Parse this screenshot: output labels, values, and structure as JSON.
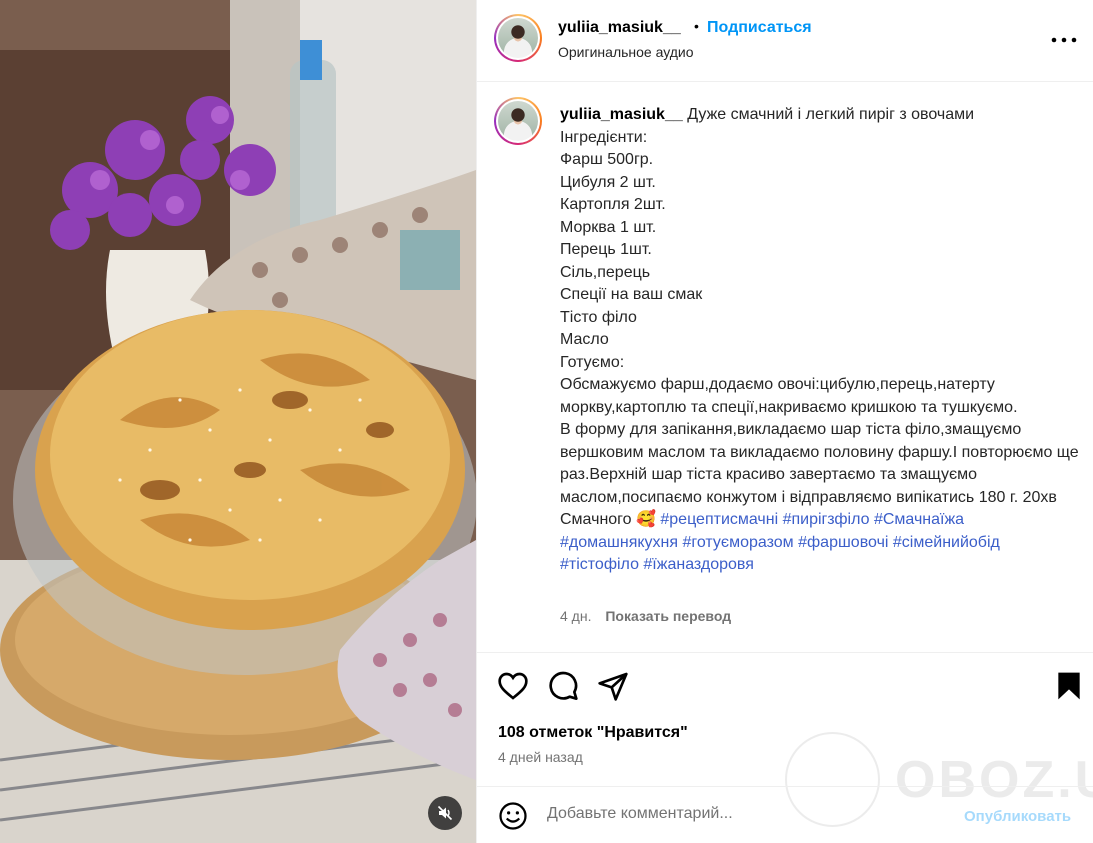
{
  "post": {
    "username": "yuliia_masiuk__",
    "separator": "•",
    "follow_label": "Подписаться",
    "audio": "Оригинальное аудио"
  },
  "caption": {
    "username": "yuliia_masiuk__",
    "text": " Дуже смачний і легкий пиріг з овочами\nІнгредієнти:\nФарш 500гр.\nЦибуля 2 шт.\nКартопля 2шт.\nМорква 1 шт.\nПерець 1шт.\nСіль,перець\nСпеції на ваш смак\nТісто філо\nМасло\nГотуємо:\nОбсмажуємо фарш,додаємо овочі:цибулю,перець,натерту морквy,картоплю та спеції,накриваємо кришкою та тушкуємо.\nВ форму для запікання,викладаємо шар тіста філо,змащуємо вершковим маслом та викладаємо половину фаршу.І повторюємо ще раз.Верхній шар тіста красиво завертаємо та змащуємо маслом,посипаємо конжутом і відправляємо випікатись 180 г. 20хв\nСмачного 🥰 ",
    "hashtags": "#рецептисмачні #пирігзфіло #Смачнаїжа #домашнякухня #готуєморазом #фаршовочі #сімейнийобід #тістофіло #їжаназдоровя"
  },
  "meta": {
    "age": "4 дн.",
    "translate_label": "Показать перевод"
  },
  "engagement": {
    "likes": "108 отметок \"Нравится\"",
    "date": "4 дней назад"
  },
  "comment": {
    "placeholder": "Добавьте комментарий...",
    "publish_label": "Опубликовать"
  },
  "watermark": "OBOZ.UA",
  "icons": [
    "more-options-icon",
    "heart-icon",
    "comment-icon",
    "share-icon",
    "bookmark-icon",
    "emoji-icon",
    "audio-muted-icon"
  ],
  "colors": {
    "accent": "#0095f6",
    "hashtag": "#3b5ec9",
    "muted_text": "#737373"
  }
}
